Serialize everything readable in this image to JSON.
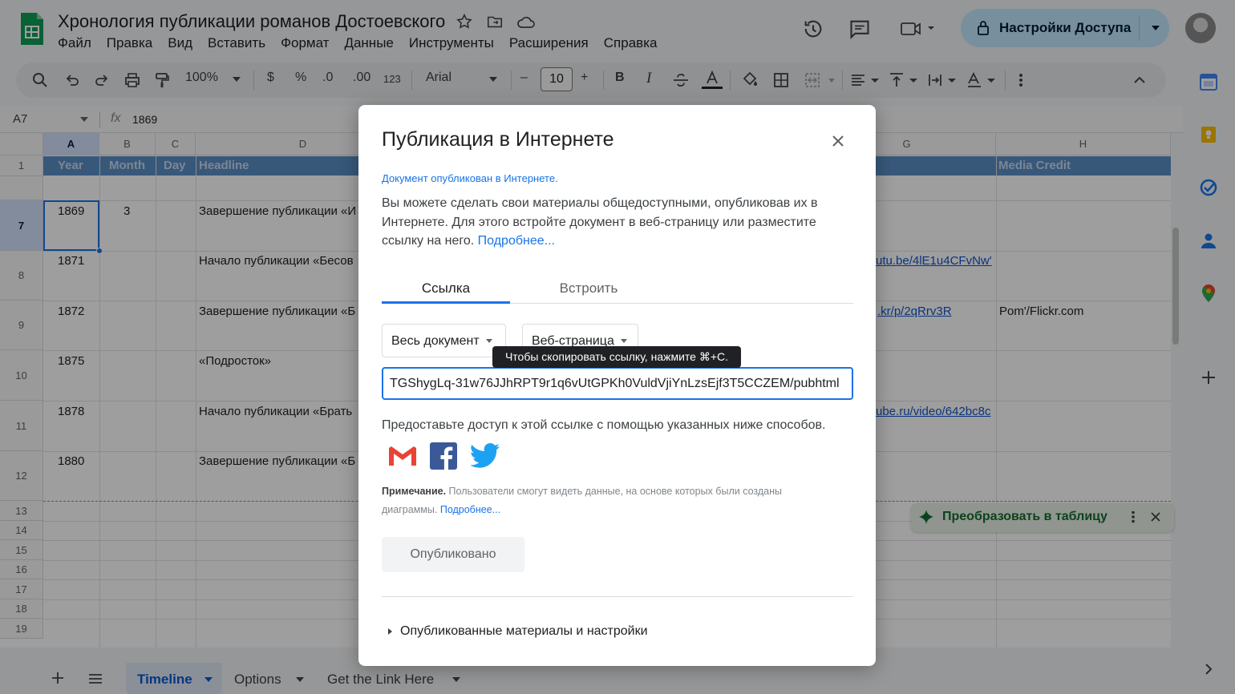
{
  "app": {
    "doc_title": "Хронология публикации романов Достоевского",
    "menu": [
      "Файл",
      "Правка",
      "Вид",
      "Вставить",
      "Формат",
      "Данные",
      "Инструменты",
      "Расширения",
      "Справка"
    ],
    "share_label": "Настройки Доступа"
  },
  "toolbar": {
    "zoom": "100%",
    "currency": "$",
    "percent": "%",
    "dec_decrease": ".0",
    "dec_increase": ".00",
    "format_123": "123",
    "font": "Arial",
    "minus": "–",
    "font_size": "10",
    "plus": "+",
    "bold": "B",
    "italic": "I"
  },
  "formula_bar": {
    "cell_ref": "A7",
    "fx": "fx",
    "value": "1869"
  },
  "grid": {
    "columns": [
      "A",
      "B",
      "C",
      "D",
      "G",
      "H"
    ],
    "headers": {
      "year": "Year",
      "month": "Month",
      "day": "Day",
      "headline": "Headline",
      "media_credit": "Media Credit"
    },
    "row_numbers": [
      "1",
      "7",
      "8",
      "9",
      "10",
      "11",
      "12",
      "13",
      "14",
      "15",
      "16",
      "17",
      "18",
      "19"
    ],
    "rows": [
      {
        "year": "1869",
        "month": "3",
        "headline": "Завершение публикации «И",
        "link": "",
        "credit": ""
      },
      {
        "year": "1871",
        "month": "",
        "headline": "Начало публикации «Бесов",
        "link": "utu.be/4lE1u4CFvNw'",
        "credit": ""
      },
      {
        "year": "1872",
        "month": "",
        "headline": "Завершение публикации «Б",
        "link": ".kr/p/2qRrv3R",
        "credit": "Pom'/Flickr.com"
      },
      {
        "year": "1875",
        "month": "",
        "headline": "«Подросток»",
        "link": "",
        "credit": ""
      },
      {
        "year": "1878",
        "month": "",
        "headline": "Начало публикации «Брать",
        "link": "ube.ru/video/642bc8c",
        "credit": ""
      },
      {
        "year": "1880",
        "month": "",
        "headline": "Завершение публикации «Б",
        "link": "",
        "credit": ""
      }
    ]
  },
  "sheets": [
    "Timeline",
    "Options",
    "Get the Link Here"
  ],
  "toast": {
    "label": "Преобразовать в таблицу"
  },
  "dialog": {
    "title": "Публикация в Интернете",
    "status": "Документ опубликован в Интернете.",
    "description": "Вы можете сделать свои материалы общедоступными, опубликовав их в Интернете. Для этого встройте документ в веб-страницу или разместите ссылку на него.",
    "learn_more": "Подробнее...",
    "tabs": [
      "Ссылка",
      "Встроить"
    ],
    "scope_select": "Весь документ",
    "format_select": "Веб-страница",
    "tooltip": "Чтобы скопировать ссылку, нажмите ⌘+C.",
    "url": "TGShygLq-31w76JJhRPT9r1q6vUtGPKh0VuldVjiYnLzsEjf3T5CCZEM/pubhtml",
    "share_text": "Предоставьте доступ к этой ссылке с помощью указанных ниже способов.",
    "note_label": "Примечание.",
    "note_text": "Пользователи смогут видеть данные, на основе которых были созданы диаграммы.",
    "note_link": "Подробнее...",
    "published_btn": "Опубликовано",
    "settings_label": "Опубликованные материалы и настройки"
  },
  "colors": {
    "accent": "#1a73e8",
    "header_fill": "#5b8ec5",
    "share_button": "#c2e7ff"
  }
}
